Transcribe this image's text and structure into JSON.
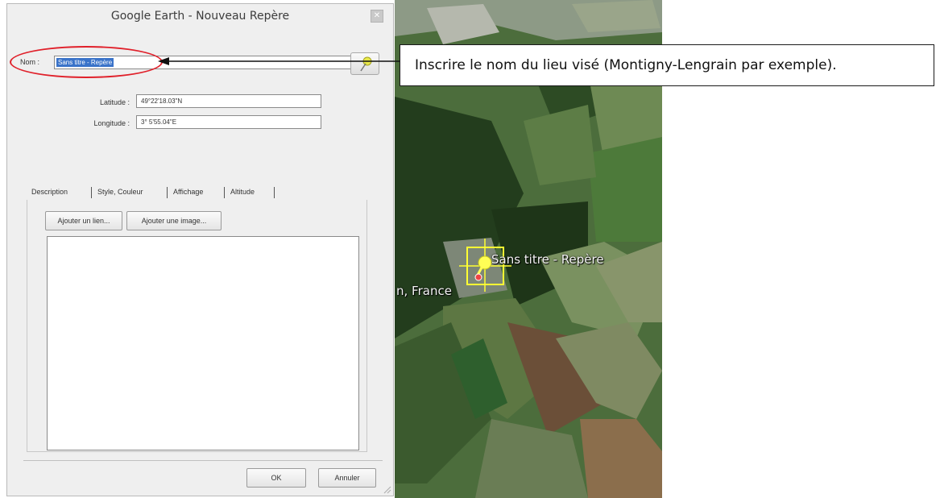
{
  "dialog": {
    "title": "Google Earth - Nouveau Repère",
    "name_label": "Nom :",
    "name_value": "Sans titre - Repère",
    "latitude_label": "Latitude :",
    "latitude_value": "49°22'18.03\"N",
    "longitude_label": "Longitude :",
    "longitude_value": "3° 5'55.04\"E",
    "tabs": [
      {
        "label": "Description"
      },
      {
        "label": "Style, Couleur"
      },
      {
        "label": "Affichage"
      },
      {
        "label": "Altitude"
      }
    ],
    "add_link_label": "Ajouter un lien...",
    "add_image_label": "Ajouter une image...",
    "description_value": "",
    "ok_label": "OK",
    "cancel_label": "Annuler"
  },
  "annotation": {
    "callout_text": "Inscrire le nom du lieu visé (Montigny-Lengrain par exemple).",
    "ellipse_color": "#e0202a"
  },
  "map": {
    "placemark_label": "Sans titre - Repère",
    "place_label": "n, France",
    "placemark_color": "#ffff33"
  }
}
